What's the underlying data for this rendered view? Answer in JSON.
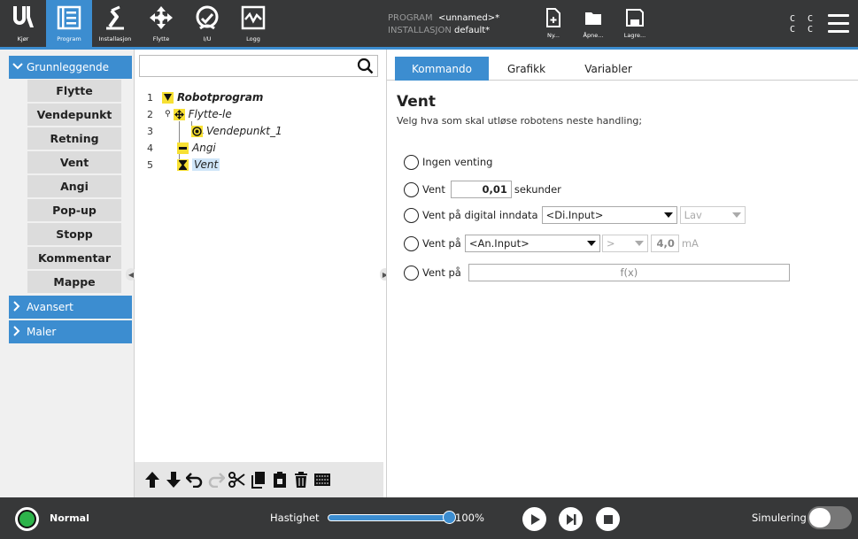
{
  "topbar": {
    "nav": [
      {
        "label": "Kjør",
        "icon": "ur-logo-icon"
      },
      {
        "label": "Program",
        "icon": "program-icon"
      },
      {
        "label": "Installasjon",
        "icon": "installation-icon"
      },
      {
        "label": "Flytte",
        "icon": "move-icon"
      },
      {
        "label": "I/U",
        "icon": "io-icon"
      },
      {
        "label": "Logg",
        "icon": "log-icon"
      }
    ],
    "program_label": "PROGRAM",
    "program_value": "<unnamed>*",
    "installation_label": "INSTALLASJON",
    "installation_value": "default*",
    "file_buttons": [
      {
        "label": "Ny...",
        "icon": "new-file-icon"
      },
      {
        "label": "Åpne...",
        "icon": "folder-open-icon"
      },
      {
        "label": "Lagre...",
        "icon": "save-icon"
      }
    ],
    "cc_row1": "C C",
    "cc_row2": "C C",
    "accent_color": "#3c8dd0"
  },
  "left_panel": {
    "categories": [
      {
        "label": "Grunnleggende",
        "expanded": true
      },
      {
        "label": "Avansert",
        "expanded": false
      },
      {
        "label": "Maler",
        "expanded": false
      }
    ],
    "basic_items": [
      "Flytte",
      "Vendepunkt",
      "Retning",
      "Vent",
      "Angi",
      "Pop-up",
      "Stopp",
      "Kommentar",
      "Mappe"
    ]
  },
  "tree": {
    "search_placeholder": "",
    "nodes": [
      {
        "num": "1",
        "label": "Robotprogram",
        "icon": "program-triangle-icon"
      },
      {
        "num": "2",
        "label": "Flytte-le",
        "icon": "move-icon"
      },
      {
        "num": "3",
        "label": "Vendepunkt_1",
        "icon": "waypoint-icon"
      },
      {
        "num": "4",
        "label": "Angi",
        "icon": "set-icon"
      },
      {
        "num": "5",
        "label": "Vent",
        "icon": "hourglass-icon",
        "selected": true
      }
    ]
  },
  "right_panel": {
    "tabs": [
      "Kommando",
      "Grafikk",
      "Variabler"
    ],
    "active_tab": "Kommando",
    "title": "Vent",
    "subtitle": "Velg hva som skal utløse robotens neste handling;",
    "opt_none": "Ingen venting",
    "opt_wait": "Vent",
    "wait_value": "0,01",
    "wait_unit": "sekunder",
    "opt_digital": "Vent på digital inndata",
    "digital_input": "<Di.Input>",
    "digital_level": "Lav",
    "opt_analog": "Vent på",
    "analog_input": "<An.Input>",
    "analog_op": ">",
    "analog_value": "4,0",
    "analog_unit": "mA",
    "opt_expr": "Vent på",
    "expr_placeholder": "f(x)"
  },
  "bottombar": {
    "status": "Normal",
    "speed_label": "Hastighet",
    "speed_value": "100%",
    "speed_fraction": 1.0,
    "sim_label": "Simulering",
    "status_color": "#2db34a"
  }
}
